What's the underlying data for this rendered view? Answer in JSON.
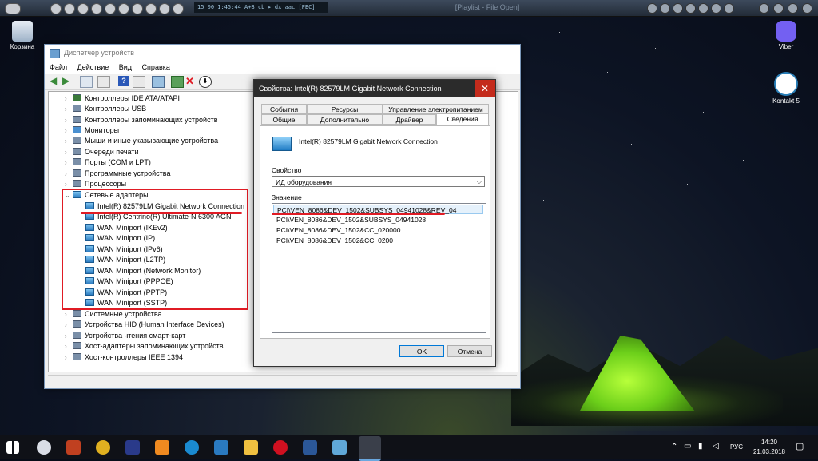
{
  "media_bar": {
    "display": "15   00   1:45:44  A+B  cb  ▸  dx  aac  [FEC]",
    "playlist": "[Playlist - File Open]"
  },
  "desktop": {
    "recycle_bin": "Корзина",
    "viber": "Viber",
    "kontakt": "Kontakt 5"
  },
  "device_manager": {
    "title": "Диспетчер устройств",
    "menu": [
      "Файл",
      "Действие",
      "Вид",
      "Справка"
    ],
    "tree": [
      "Контроллеры IDE ATA/ATAPI",
      "Контроллеры USB",
      "Контроллеры запоминающих устройств",
      "Мониторы",
      "Мыши и иные указывающие устройства",
      "Очереди печати",
      "Порты (COM и LPT)",
      "Программные устройства",
      "Процессоры",
      "Сетевые адаптеры",
      "Intel(R) 82579LM Gigabit Network Connection",
      "Intel(R) Centrino(R) Ultimate-N 6300 AGN",
      "WAN Miniport (IKEv2)",
      "WAN Miniport (IP)",
      "WAN Miniport (IPv6)",
      "WAN Miniport (L2TP)",
      "WAN Miniport (Network Monitor)",
      "WAN Miniport (PPPOE)",
      "WAN Miniport (PPTP)",
      "WAN Miniport (SSTP)",
      "Системные устройства",
      "Устройства HID (Human Interface Devices)",
      "Устройства чтения смарт-карт",
      "Хост-адаптеры запоминающих устройств",
      "Хост-контроллеры IEEE 1394"
    ]
  },
  "properties": {
    "title": "Свойства: Intel(R) 82579LM Gigabit Network Connection",
    "close": "✕",
    "tabs_row1": [
      "События",
      "Ресурсы",
      "Управление электропитанием"
    ],
    "tabs_row2": [
      "Общие",
      "Дополнительно",
      "Драйвер",
      "Сведения"
    ],
    "device_name": "Intel(R) 82579LM Gigabit Network Connection",
    "property_label": "Свойство",
    "property_value": "ИД оборудования",
    "value_label": "Значение",
    "values": [
      "PCI\\VEN_8086&DEV_1502&SUBSYS_04941028&REV_04",
      "PCI\\VEN_8086&DEV_1502&SUBSYS_04941028",
      "PCI\\VEN_8086&DEV_1502&CC_020000",
      "PCI\\VEN_8086&DEV_1502&CC_0200"
    ],
    "ok": "OK",
    "cancel": "Отмена"
  },
  "taskbar": {
    "lang": "РУС",
    "time": "14:20",
    "date": "21.03.2018"
  }
}
